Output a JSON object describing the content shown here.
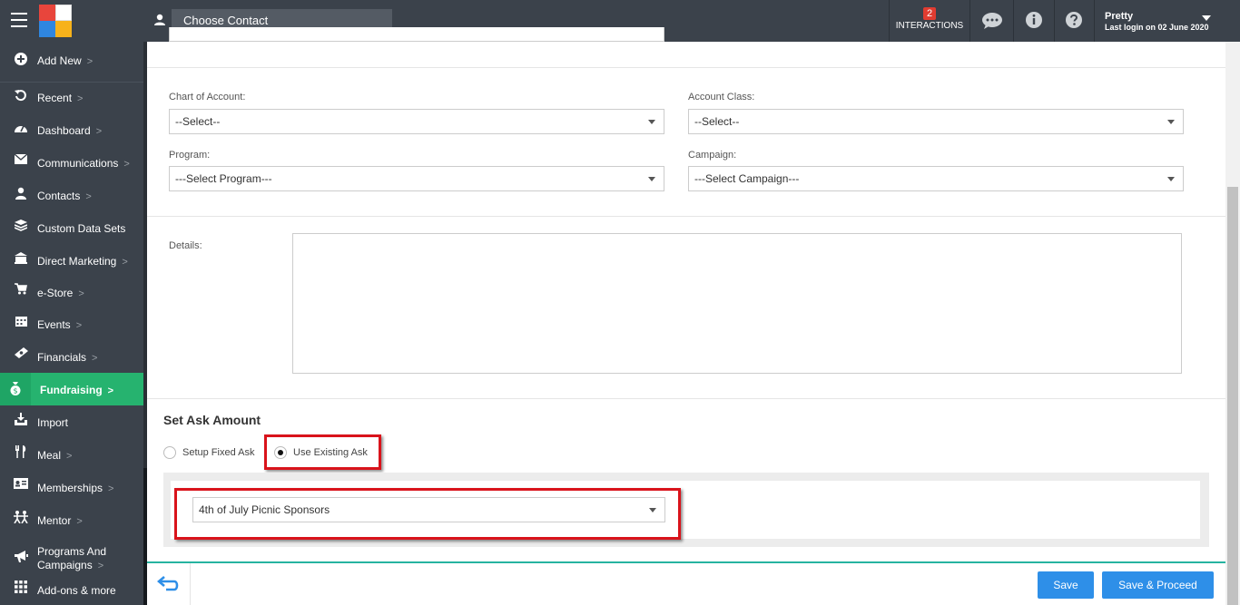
{
  "topbar": {
    "contact_placeholder": "Choose Contact",
    "interactions_count": "2",
    "interactions_label": "INTERACTIONS",
    "user_name": "Pretty",
    "last_login": "Last login on 02 June 2020"
  },
  "sidebar": {
    "items": [
      {
        "label": "Add New",
        "icon": "plus-circle-icon"
      },
      {
        "label": "Recent",
        "icon": "history-icon"
      },
      {
        "label": "Dashboard",
        "icon": "dashboard-icon"
      },
      {
        "label": "Communications",
        "icon": "envelope-icon"
      },
      {
        "label": "Contacts",
        "icon": "user-icon"
      },
      {
        "label": "Custom Data Sets",
        "icon": "layers-icon"
      },
      {
        "label": "Direct Marketing",
        "icon": "bank-icon"
      },
      {
        "label": "e-Store",
        "icon": "cart-icon"
      },
      {
        "label": "Events",
        "icon": "calendar-icon"
      },
      {
        "label": "Financials",
        "icon": "money-icon"
      },
      {
        "label": "Fundraising",
        "icon": "moneybag-icon",
        "active": true
      },
      {
        "label": "Import",
        "icon": "import-icon"
      },
      {
        "label": "Meal",
        "icon": "cutlery-icon"
      },
      {
        "label": "Memberships",
        "icon": "id-card-icon"
      },
      {
        "label": "Mentor",
        "icon": "mentor-icon"
      },
      {
        "label": "Programs And",
        "label2": "Campaigns",
        "icon": "megaphone-icon"
      },
      {
        "label": "Add-ons & more",
        "icon": "grid-icon"
      }
    ],
    "chevron": ">"
  },
  "form": {
    "chart_of_account_label": "Chart of Account:",
    "chart_of_account_value": "--Select--",
    "account_class_label": "Account Class:",
    "account_class_value": "--Select--",
    "program_label": "Program:",
    "program_value": "---Select Program---",
    "campaign_label": "Campaign:",
    "campaign_value": "---Select Campaign---",
    "details_label": "Details:"
  },
  "ask": {
    "title": "Set Ask Amount",
    "option_fixed": "Setup Fixed Ask",
    "option_existing": "Use Existing Ask",
    "selected_option": "Use Existing Ask",
    "existing_ask_value": "4th of July Picnic Sponsors"
  },
  "footer": {
    "save_label": "Save",
    "save_proceed_label": "Save & Proceed"
  },
  "colors": {
    "topbar": "#3b424b",
    "active_nav": "#26b36f",
    "primary_button": "#2e8fe8",
    "highlight": "#d9131b"
  }
}
